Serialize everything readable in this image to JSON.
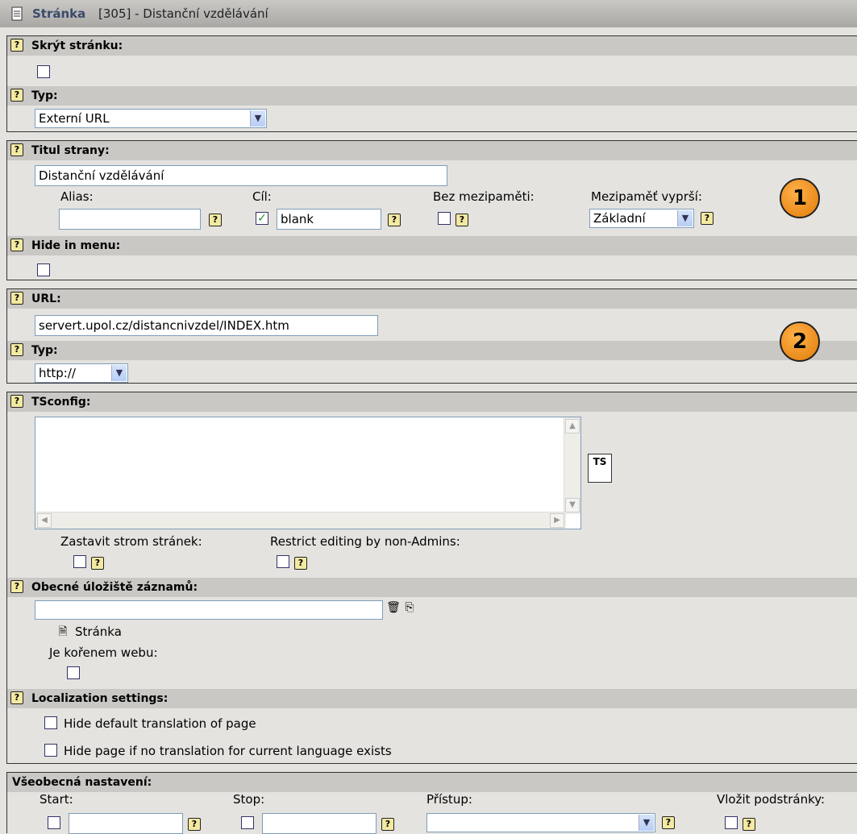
{
  "window": {
    "title_bold": "Stránka",
    "title_rest": "[305] - Distanční vzdělávání"
  },
  "help_glyph": "?",
  "section1": {
    "hide_page_label": "Skrýt stránku:",
    "type_label": "Typ:",
    "type_value": "Externí URL"
  },
  "section2": {
    "title_label": "Titul strany:",
    "title_value": "Distanční vzdělávání",
    "alias_label": "Alias:",
    "alias_value": "",
    "target_label": "Cíl:",
    "target_value": "blank",
    "no_cache_label": "Bez mezipaměti:",
    "cache_expires_label": "Mezipaměť vyprší:",
    "cache_expires_value": "Základní",
    "hide_menu_label": "Hide in menu:",
    "badge": "1"
  },
  "section3": {
    "url_label": "URL:",
    "url_value": "servert.upol.cz/distancnivzdel/INDEX.htm",
    "type_label": "Typ:",
    "type_value": "http://",
    "badge": "2"
  },
  "section4": {
    "tsconfig_label": "TSconfig:",
    "tsconfig_value": "",
    "ts_button": "TS",
    "stop_tree_label": "Zastavit strom stránek:",
    "restrict_label": "Restrict editing by non-Admins:",
    "storage_label": "Obecné úložiště záznamů:",
    "storage_item": "Stránka",
    "root_label": "Je kořenem webu:",
    "localization_label": "Localization settings:",
    "hide_default_label": "Hide default translation of page",
    "hide_no_translation_label": "Hide page if no translation for current language exists"
  },
  "section5": {
    "general_label": "Všeobecná nastavení:",
    "start_label": "Start:",
    "stop_label": "Stop:",
    "access_label": "Přístup:",
    "include_sub_label": "Vložit podstránky:"
  },
  "colors": {
    "titlebar": "#b9b8b5",
    "header_row": "#c9c8c4",
    "background": "#e4e3df",
    "badge": "#f18d1a",
    "help_icon": "#f3e9a0"
  }
}
